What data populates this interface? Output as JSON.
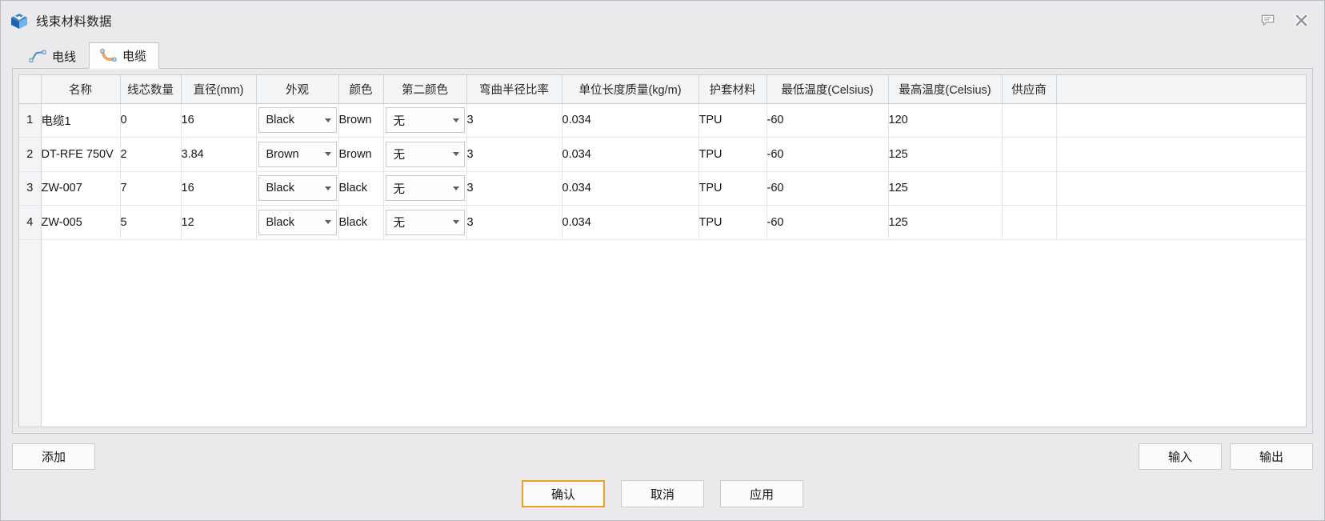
{
  "window": {
    "title": "线束材料数据",
    "app_icon": "harness-app-icon",
    "controls": [
      {
        "name": "comment-icon",
        "label": ""
      },
      {
        "name": "close-icon",
        "label": ""
      }
    ]
  },
  "tabs": [
    {
      "id": "wire",
      "label": "电线",
      "icon": "wire-icon",
      "active": false
    },
    {
      "id": "cable",
      "label": "电缆",
      "icon": "cable-icon",
      "active": true
    }
  ],
  "table": {
    "columns": [
      "名称",
      "线芯数量",
      "直径(mm)",
      "外观",
      "颜色",
      "第二颜色",
      "弯曲半径比率",
      "单位长度质量(kg/m)",
      "护套材料",
      "最低温度(Celsius)",
      "最高温度(Celsius)",
      "供应商"
    ],
    "rows": [
      {
        "index": "1",
        "name": "电缆1",
        "core_count": "0",
        "diameter": "16",
        "appearance": "Black",
        "color": "Brown",
        "second_color": "无",
        "bend_radius_ratio": "3",
        "mass_per_length": "0.034",
        "jacket_material": "TPU",
        "min_temp": "-60",
        "max_temp": "120",
        "supplier": ""
      },
      {
        "index": "2",
        "name": "DT-RFE 750V",
        "core_count": "2",
        "diameter": "3.84",
        "appearance": "Brown",
        "color": "Brown",
        "second_color": "无",
        "bend_radius_ratio": "3",
        "mass_per_length": "0.034",
        "jacket_material": "TPU",
        "min_temp": "-60",
        "max_temp": "125",
        "supplier": ""
      },
      {
        "index": "3",
        "name": "ZW-007",
        "core_count": "7",
        "diameter": "16",
        "appearance": "Black",
        "color": "Black",
        "second_color": "无",
        "bend_radius_ratio": "3",
        "mass_per_length": "0.034",
        "jacket_material": "TPU",
        "min_temp": "-60",
        "max_temp": "125",
        "supplier": ""
      },
      {
        "index": "4",
        "name": "ZW-005",
        "core_count": "5",
        "diameter": "12",
        "appearance": "Black",
        "color": "Black",
        "second_color": "无",
        "bend_radius_ratio": "3",
        "mass_per_length": "0.034",
        "jacket_material": "TPU",
        "min_temp": "-60",
        "max_temp": "125",
        "supplier": ""
      }
    ]
  },
  "footer": {
    "add_label": "添加",
    "import_label": "输入",
    "export_label": "输出"
  },
  "actions": {
    "confirm_label": "确认",
    "cancel_label": "取消",
    "apply_label": "应用"
  },
  "colors": {
    "window_bg": "#eaeaec",
    "grid_bg": "#ffffff",
    "header_bg": "#f3f4f6",
    "default_button_border": "#e8a317",
    "wire_icon": "#4f86b0",
    "cable_icon": "#d08a3c"
  }
}
